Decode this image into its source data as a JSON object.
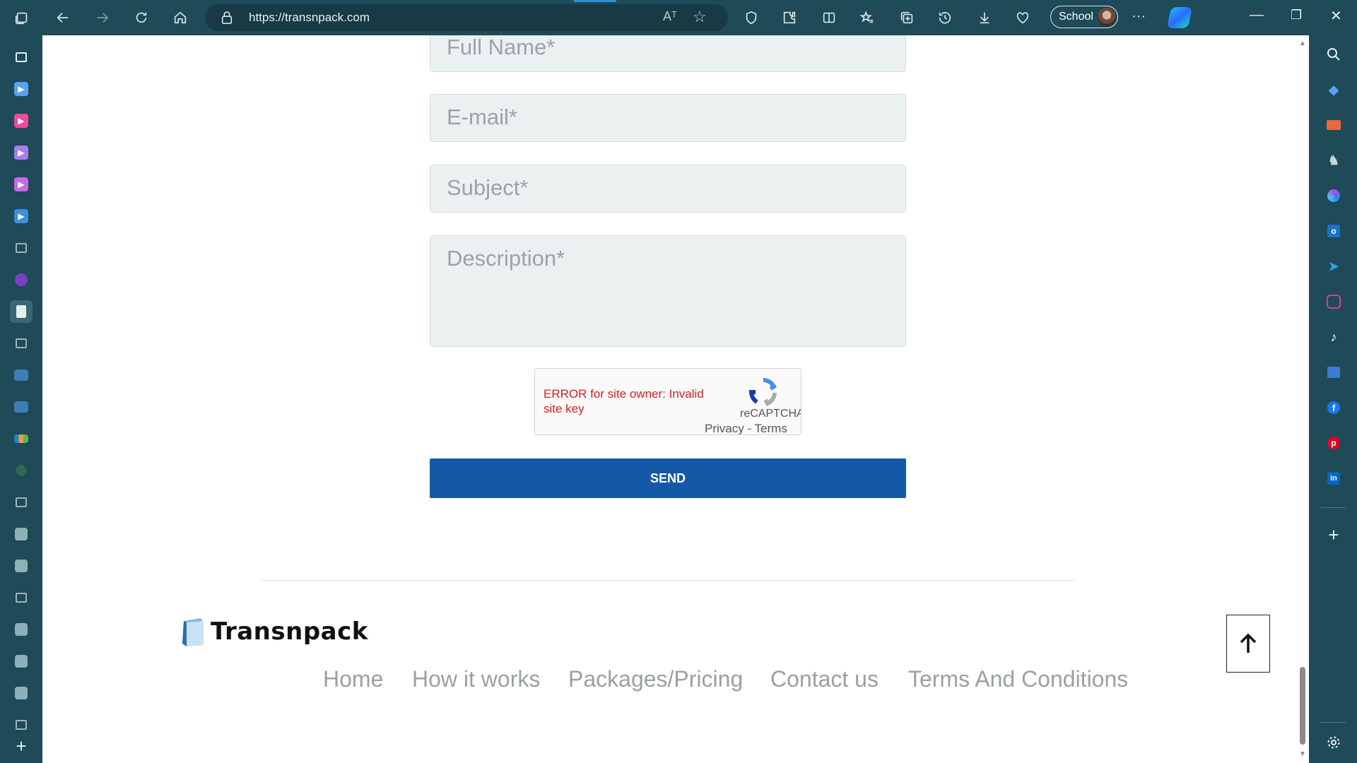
{
  "browser": {
    "url": "https://transnpack.com",
    "profile_label": "School",
    "read_aloud_label": "Aᵀ"
  },
  "form": {
    "full_name_placeholder": "Full Name*",
    "email_placeholder": "E-mail*",
    "subject_placeholder": "Subject*",
    "description_placeholder": "Description*",
    "send_label": "SEND"
  },
  "recaptcha": {
    "error_text": "ERROR for site owner: Invalid site key",
    "brand": "reCAPTCHA",
    "privacy": "Privacy",
    "separator": " - ",
    "terms": "Terms"
  },
  "footer": {
    "brand": "Transnpack",
    "nav": [
      "Home",
      "How it works",
      "Packages/Pricing",
      "Contact us",
      "Terms And Conditions"
    ]
  },
  "colors": {
    "browser_chrome": "#1f4a57",
    "send_button": "#1459a8",
    "error_text": "#d81e1e"
  }
}
